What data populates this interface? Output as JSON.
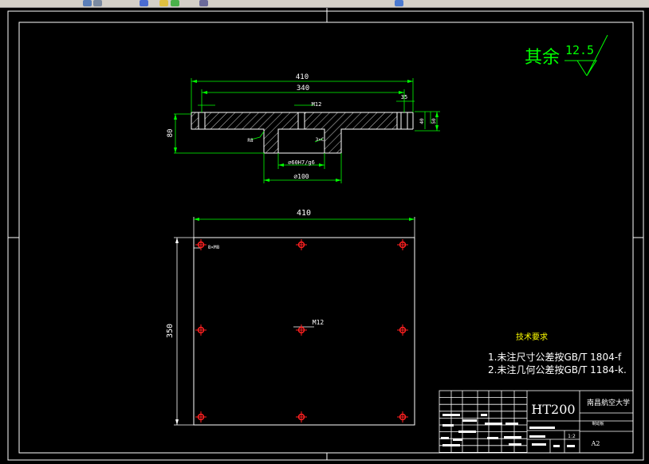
{
  "toolbar": {
    "icons": [
      "save-icon",
      "print-icon",
      "layer-icon",
      "undo-icon",
      "redo-icon",
      "properties-icon",
      "zoom-icon"
    ]
  },
  "section_view": {
    "dim_overall_width": "410",
    "dim_bolt_span": "340",
    "dim_height": "80",
    "dim_right_a": "35",
    "dim_right_b": "40",
    "dim_right_c": "50",
    "thread_label": "M12",
    "hub_bore_label": "⌀60H7/g6",
    "hub_outer_label": "⌀100",
    "left_note": "R8",
    "right_note": "3×C"
  },
  "plan_view": {
    "dim_width": "410",
    "dim_height": "350",
    "hole_note": "8×M8",
    "center_label": "M12"
  },
  "roughness": {
    "prefix": "其余",
    "value": "12.5"
  },
  "tech_requirements": {
    "title": "技术要求",
    "line1": "1.未注尺寸公差按GB/T 1804-f",
    "line2": "2.未注几何公差按GB/T 1184-k."
  },
  "title_block": {
    "material": "HT200",
    "school": "南昌航空大学",
    "part_name": "制动板",
    "sheet_size": "A2",
    "scale": "1:2"
  },
  "colors": {
    "background": "#000000",
    "lines": "#ffffff",
    "dimensions": "#00ff00",
    "holes": "#ff2020",
    "notes": "#ffff00"
  }
}
